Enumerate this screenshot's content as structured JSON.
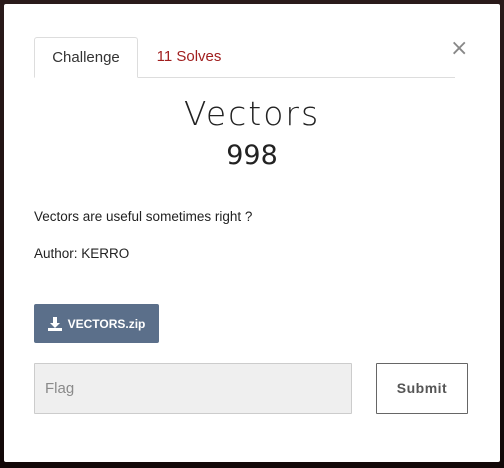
{
  "modal": {
    "close_glyph": "×",
    "tabs": [
      {
        "label": "Challenge"
      },
      {
        "label": "11 Solves"
      }
    ],
    "challenge": {
      "name": "Vectors",
      "value": "998",
      "description": "Vectors are useful sometimes right ?",
      "author": "Author: KERRO"
    },
    "file": {
      "label": "VECTORS.zip",
      "icon": "download-icon"
    },
    "flag_input": {
      "placeholder": "Flag",
      "value": ""
    },
    "submit_label": "Submit"
  },
  "colors": {
    "solves_tab": "#a01e1e",
    "file_button": "#5b6f8a"
  }
}
